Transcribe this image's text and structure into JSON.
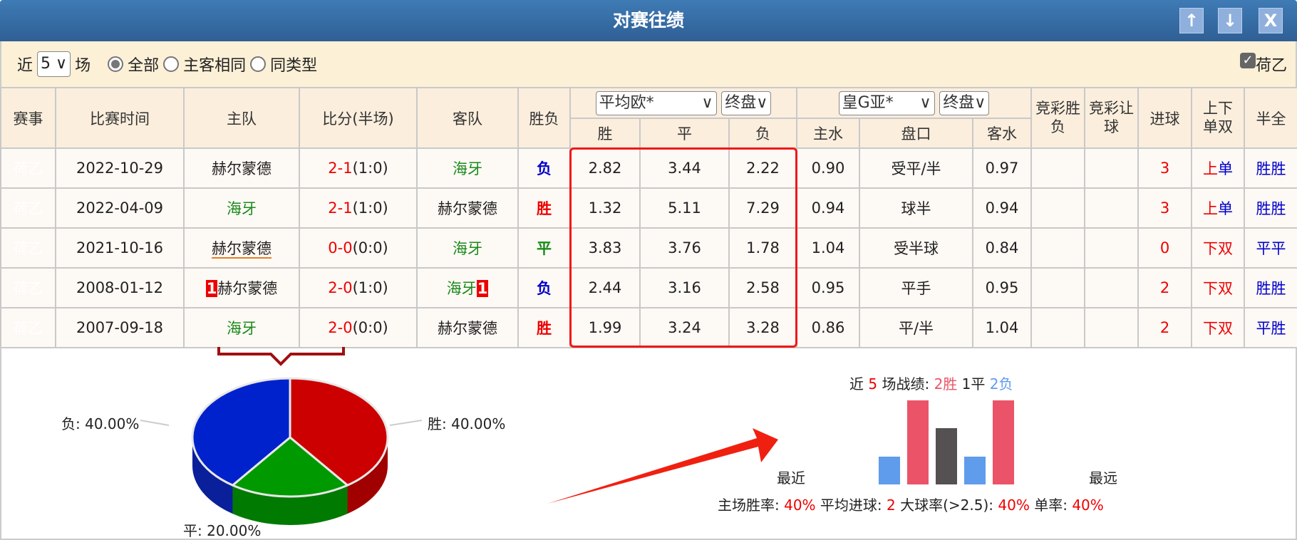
{
  "title": "对赛往绩",
  "window_buttons": {
    "up": "↑",
    "down": "↓",
    "close": "X"
  },
  "filter": {
    "prefix": "近",
    "count": "5",
    "suffix": "场",
    "options": [
      "全部",
      "主客相同",
      "同类型"
    ],
    "selected": "全部",
    "league_checkbox": "荷乙",
    "league_checked": true
  },
  "headers": {
    "league": "赛事",
    "date": "比赛时间",
    "home": "主队",
    "score": "比分(半场)",
    "away": "客队",
    "result": "胜负",
    "euro_company": "平均欧*",
    "euro_type": "终盘",
    "euro_cols": [
      "胜",
      "平",
      "负"
    ],
    "asia_company": "皇G亚*",
    "asia_type": "终盘",
    "asia_cols": [
      "主水",
      "盘口",
      "客水"
    ],
    "jc_wl": "竞彩胜负",
    "jc_hc": "竞彩让球",
    "goals": "进球",
    "ou": "上下单双",
    "hf": "半全"
  },
  "rows": [
    {
      "league": "荷乙",
      "date": "2022-10-29",
      "home": "赫尔蒙德",
      "score": "2-1",
      "half": "(1:0)",
      "away": "海牙",
      "result": "负",
      "eu": [
        "2.82",
        "3.44",
        "2.22"
      ],
      "as": [
        "0.90",
        "受平/半",
        "0.97"
      ],
      "jc_wl": "",
      "jc_hc": "",
      "goals": "3",
      "ou1": "上",
      "ou2": "单",
      "hf": "胜胜"
    },
    {
      "league": "荷乙",
      "date": "2022-04-09",
      "home": "海牙",
      "score": "2-1",
      "half": "(1:0)",
      "away": "赫尔蒙德",
      "result": "胜",
      "eu": [
        "1.32",
        "5.11",
        "7.29"
      ],
      "as": [
        "0.94",
        "球半",
        "0.94"
      ],
      "jc_wl": "",
      "jc_hc": "",
      "goals": "3",
      "ou1": "上",
      "ou2": "单",
      "hf": "胜胜"
    },
    {
      "league": "荷乙",
      "date": "2021-10-16",
      "home": "赫尔蒙德",
      "score": "0-0",
      "half": "(0:0)",
      "away": "海牙",
      "result": "平",
      "eu": [
        "3.83",
        "3.76",
        "1.78"
      ],
      "as": [
        "1.04",
        "受半球",
        "0.84"
      ],
      "jc_wl": "",
      "jc_hc": "",
      "goals": "0",
      "ou1": "下",
      "ou2": "双",
      "hf": "平平"
    },
    {
      "league": "荷乙",
      "date": "2008-01-12",
      "home_badge": "1",
      "home": "赫尔蒙德",
      "score": "2-0",
      "half": "(1:0)",
      "away": "海牙",
      "away_badge": "1",
      "result": "负",
      "eu": [
        "2.44",
        "3.16",
        "2.58"
      ],
      "as": [
        "0.95",
        "平手",
        "0.95"
      ],
      "jc_wl": "",
      "jc_hc": "",
      "goals": "2",
      "ou1": "下",
      "ou2": "双",
      "hf": "胜胜"
    },
    {
      "league": "荷乙",
      "date": "2007-09-18",
      "home": "海牙",
      "score": "2-0",
      "half": "(0:0)",
      "away": "赫尔蒙德",
      "result": "胜",
      "eu": [
        "1.99",
        "3.24",
        "3.28"
      ],
      "as": [
        "0.86",
        "平/半",
        "1.04"
      ],
      "jc_wl": "",
      "jc_hc": "",
      "goals": "2",
      "ou1": "下",
      "ou2": "双",
      "hf": "平胜"
    }
  ],
  "chart_data": [
    {
      "type": "pie",
      "slices": [
        {
          "label": "胜: 40.00%",
          "name": "胜",
          "value": 40,
          "color": "#cc0000"
        },
        {
          "label": "平: 20.00%",
          "name": "平",
          "value": 20,
          "color": "#009900"
        },
        {
          "label": "负: 40.00%",
          "name": "负",
          "value": 40,
          "color": "#0022cc"
        }
      ]
    },
    {
      "type": "bar",
      "title_parts": {
        "a": "近",
        "n": "5",
        "b": "场战绩:",
        "w": "2胜",
        "d": "1平",
        "l": "2负"
      },
      "categories": [
        "负",
        "胜",
        "平",
        "负",
        "胜"
      ],
      "values": [
        1,
        3,
        2,
        1,
        3
      ],
      "colors": {
        "胜": "#eb5468",
        "平": "#555153",
        "负": "#5f9cec"
      },
      "left_label": "最近",
      "right_label": "最远"
    }
  ],
  "stats": {
    "home_win_label": "主场胜率:",
    "home_win": "40%",
    "avg_goals_label": "平均进球:",
    "avg_goals": "2",
    "big_label": "大球率(>2.5):",
    "big": "40%",
    "odd_label": "单率:",
    "odd": "40%"
  }
}
